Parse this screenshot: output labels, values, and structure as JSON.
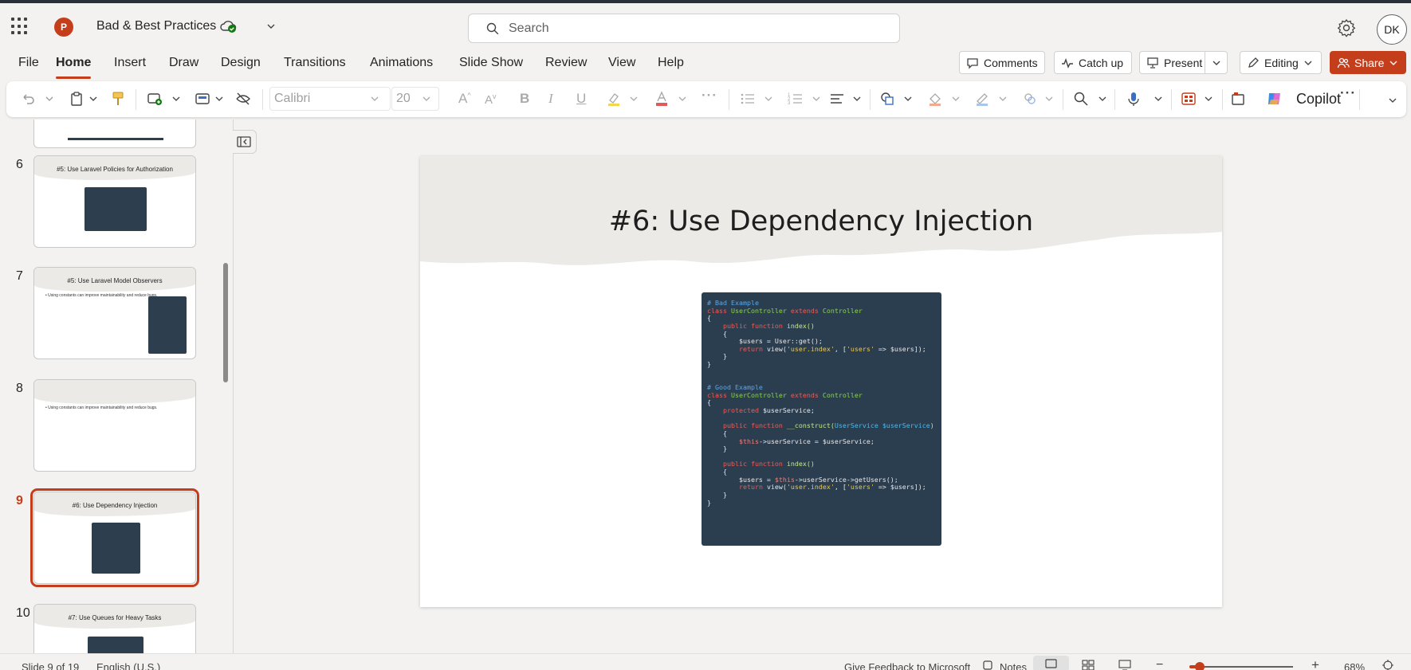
{
  "app": {
    "title": "Bad & Best Practices",
    "logo_letter": "P",
    "search_placeholder": "Search",
    "user_initials": "DK"
  },
  "menu": {
    "tabs": [
      "File",
      "Home",
      "Insert",
      "Draw",
      "Design",
      "Transitions",
      "Animations",
      "Slide Show",
      "Review",
      "View",
      "Help"
    ],
    "active_tab": "Home"
  },
  "actions": {
    "comments": "Comments",
    "catch_up": "Catch up",
    "present": "Present",
    "editing": "Editing",
    "share": "Share"
  },
  "ribbon": {
    "font_name": "Calibri",
    "font_size": "20",
    "copilot": "Copilot"
  },
  "thumbnails": [
    {
      "number": "6",
      "title": "#5: Use Laravel Policies for Authorization"
    },
    {
      "number": "7",
      "title": "#5: Use Laravel Model Observers",
      "bullet": "• Using constants can improve maintainability and reduce bugs."
    },
    {
      "number": "8",
      "title": "",
      "bullet": "• Using constants can improve maintainability and reduce bugs."
    },
    {
      "number": "9",
      "title": "#6: Use Dependency Injection"
    },
    {
      "number": "10",
      "title": "#7: Use Queues for Heavy Tasks"
    }
  ],
  "selected_slide": "9",
  "slide": {
    "title": "#6: Use Dependency Injection",
    "code": [
      [
        [
          "c-cmt",
          "# Bad Example"
        ]
      ],
      [
        [
          "c-kw",
          "class "
        ],
        [
          "c-cls",
          "UserController "
        ],
        [
          "c-kw",
          "extends "
        ],
        [
          "c-cls",
          "Controller"
        ]
      ],
      [
        [
          "",
          "{"
        ]
      ],
      [
        [
          "",
          "    "
        ],
        [
          "c-kw",
          "public function "
        ],
        [
          "c-fn",
          "index()"
        ]
      ],
      [
        [
          "",
          "    {"
        ]
      ],
      [
        [
          "",
          "        $users = User::get();"
        ]
      ],
      [
        [
          "",
          "        "
        ],
        [
          "c-kw",
          "return "
        ],
        [
          "",
          "view("
        ],
        [
          "c-str",
          "'user.index'"
        ],
        [
          "",
          ", ["
        ],
        [
          "c-str",
          "'users'"
        ],
        [
          "",
          " => $users]);"
        ]
      ],
      [
        [
          "",
          "    }"
        ]
      ],
      [
        [
          "",
          "}"
        ]
      ],
      [
        [
          "",
          ""
        ]
      ],
      [
        [
          "",
          ""
        ]
      ],
      [
        [
          "c-cmt",
          "# Good Example"
        ]
      ],
      [
        [
          "c-kw",
          "class "
        ],
        [
          "c-cls",
          "UserController "
        ],
        [
          "c-kw",
          "extends "
        ],
        [
          "c-cls",
          "Controller"
        ]
      ],
      [
        [
          "",
          "{"
        ]
      ],
      [
        [
          "",
          "    "
        ],
        [
          "c-kw",
          "protected "
        ],
        [
          "",
          "$userService;"
        ]
      ],
      [
        [
          "",
          ""
        ]
      ],
      [
        [
          "",
          "    "
        ],
        [
          "c-kw",
          "public function "
        ],
        [
          "c-fn",
          "__construct("
        ],
        [
          "c-typ",
          "UserService $userService"
        ],
        [
          "c-fn",
          ")"
        ]
      ],
      [
        [
          "",
          "    {"
        ]
      ],
      [
        [
          "",
          "        "
        ],
        [
          "c-var",
          "$this"
        ],
        [
          "",
          "->userService = $userService;"
        ]
      ],
      [
        [
          "",
          "    }"
        ]
      ],
      [
        [
          "",
          ""
        ]
      ],
      [
        [
          "",
          "    "
        ],
        [
          "c-kw",
          "public function "
        ],
        [
          "c-fn",
          "index()"
        ]
      ],
      [
        [
          "",
          "    {"
        ]
      ],
      [
        [
          "",
          "        $users = "
        ],
        [
          "c-var",
          "$this"
        ],
        [
          "",
          "->userService->getUsers();"
        ]
      ],
      [
        [
          "",
          "        "
        ],
        [
          "c-kw",
          "return "
        ],
        [
          "",
          "view("
        ],
        [
          "c-str",
          "'user.index'"
        ],
        [
          "",
          ", ["
        ],
        [
          "c-str",
          "'users'"
        ],
        [
          "",
          " => $users]);"
        ]
      ],
      [
        [
          "",
          "    }"
        ]
      ],
      [
        [
          "",
          "}"
        ]
      ]
    ]
  },
  "status": {
    "slide_info": "Slide 9 of 19",
    "language": "English (U.S.)",
    "feedback": "Give Feedback to Microsoft",
    "notes": "Notes",
    "zoom": "68%",
    "zoom_fraction": 0.1
  },
  "colors": {
    "accent": "#c43e1c",
    "code_bg": "#2b3e50",
    "slide_band": "#ebeae6"
  }
}
